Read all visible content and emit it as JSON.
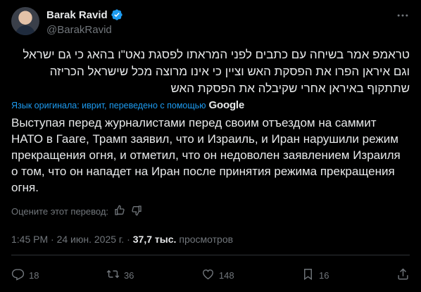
{
  "author": {
    "name": "Barak Ravid",
    "handle": "@BarakRavid"
  },
  "tweet": {
    "original_text": "טראמפ אמר בשיחה עם כתבים לפני המראתו לפסגת נאט\"ו בהאג כי גם ישראל וגם איראן הפרו את הפסקת האש וציין כי אינו מרוצה מכל שישראל הכריזה שתתקוף באיראן אחרי שקיבלה את הפסקת האש",
    "translation_note": "Язык оригинала: иврит, переведено с помощью",
    "translation_provider": "Google",
    "translated_text": "Выступая перед журналистами перед своим отъездом на саммит НАТО в Гааге, Трамп заявил, что и Израиль, и Иран нарушили режим прекращения огня, и отметил, что он недоволен заявлением Израиля о том, что он нападет на Иран после принятия режима прекращения огня.",
    "rate_prompt": "Оцените этот перевод:"
  },
  "meta": {
    "time_date": "1:45 PM · 24 июн. 2025 г. ·",
    "views_count": "37,7 тыс.",
    "views_label": "просмотров"
  },
  "actions": {
    "replies": "18",
    "reposts": "36",
    "likes": "148",
    "bookmarks": "16"
  },
  "colors": {
    "background": "#000000",
    "text": "#e7e9ea",
    "secondary": "#71767b",
    "accent": "#1d9bf0"
  },
  "icons": [
    "verified-badge-icon",
    "more-icon",
    "thumbs-up-icon",
    "thumbs-down-icon",
    "reply-icon",
    "repost-icon",
    "like-icon",
    "views-icon",
    "bookmark-icon",
    "share-icon"
  ]
}
